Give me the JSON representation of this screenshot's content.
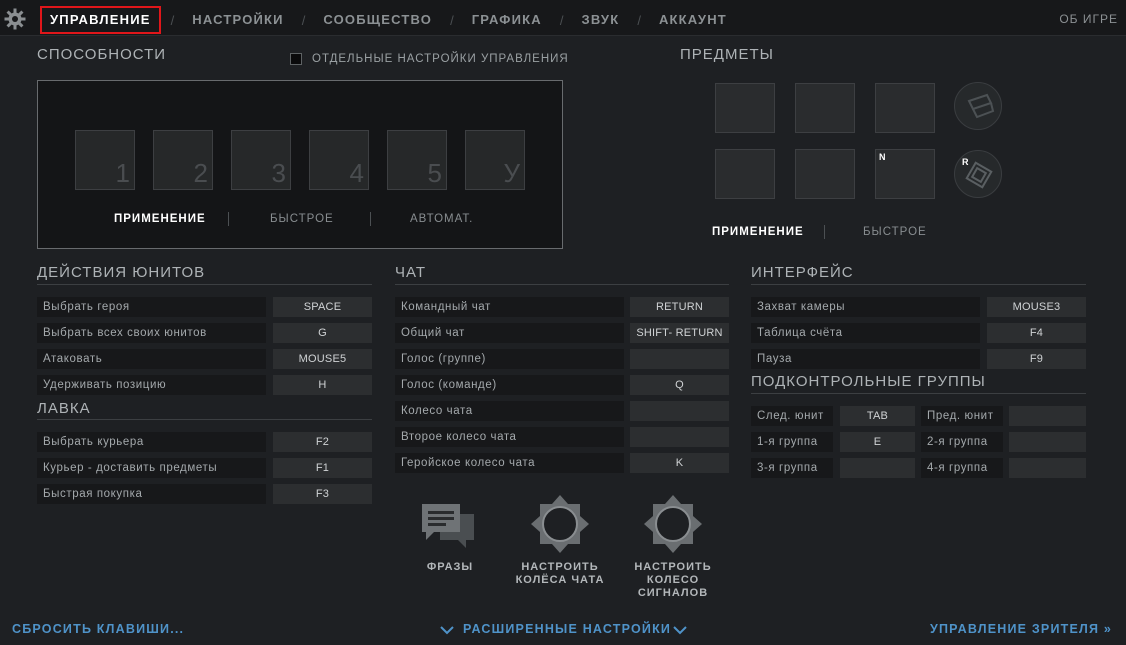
{
  "nav": {
    "tabs": [
      "УПРАВЛЕНИЕ",
      "НАСТРОЙКИ",
      "СООБЩЕСТВО",
      "ГРАФИКА",
      "ЗВУК",
      "АККАУНТ"
    ],
    "separator": "/",
    "about": "ОБ ИГРЕ"
  },
  "abilities": {
    "title": "СПОСОБНОСТИ",
    "separate_settings_label": "ОТДЕЛЬНЫЕ НАСТРОЙКИ УПРАВЛЕНИЯ",
    "slot_keys": [
      "1",
      "2",
      "3",
      "4",
      "5",
      "У"
    ],
    "modes": [
      "ПРИМЕНЕНИЕ",
      "БЫСТРОЕ",
      "АВТОМАТ."
    ]
  },
  "items": {
    "title": "ПРЕДМЕТЫ",
    "n_key": "N",
    "r_key": "R",
    "modes": [
      "ПРИМЕНЕНИЕ",
      "БЫСТРОЕ"
    ]
  },
  "unit_actions": {
    "title": "ДЕЙСТВИЯ ЮНИТОВ",
    "rows": [
      {
        "label": "Выбрать героя",
        "key": "SPACE"
      },
      {
        "label": "Выбрать всех своих юнитов",
        "key": "G"
      },
      {
        "label": "Атаковать",
        "key": "MOUSE5"
      },
      {
        "label": "Удерживать позицию",
        "key": "H"
      }
    ]
  },
  "shop": {
    "title": "ЛАВКА",
    "rows": [
      {
        "label": "Выбрать курьера",
        "key": "F2"
      },
      {
        "label": "Курьер - доставить предметы",
        "key": "F1"
      },
      {
        "label": "Быстрая покупка",
        "key": "F3"
      }
    ]
  },
  "chat": {
    "title": "ЧАТ",
    "rows": [
      {
        "label": "Командный чат",
        "key": "RETURN"
      },
      {
        "label": "Общий чат",
        "key": "SHIFT- RETURN"
      },
      {
        "label": "Голос (группе)",
        "key": ""
      },
      {
        "label": "Голос (команде)",
        "key": "Q"
      },
      {
        "label": "Колесо чата",
        "key": ""
      },
      {
        "label": "Второе колесо чата",
        "key": ""
      },
      {
        "label": "Геройское колесо чата",
        "key": "K"
      }
    ]
  },
  "interface": {
    "title": "ИНТЕРФЕЙС",
    "rows": [
      {
        "label": "Захват камеры",
        "key": "MOUSE3"
      },
      {
        "label": "Таблица счёта",
        "key": "F4"
      },
      {
        "label": "Пауза",
        "key": "F9"
      }
    ]
  },
  "control_groups": {
    "title": "ПОДКОНТРОЛЬНЫЕ ГРУППЫ",
    "rows": [
      {
        "label": "След. юнит",
        "key": "TAB",
        "label2": "Пред. юнит",
        "key2": ""
      },
      {
        "label": "1-я группа",
        "key": "E",
        "label2": "2-я группа",
        "key2": ""
      },
      {
        "label": "3-я группа",
        "key": "",
        "label2": "4-я группа",
        "key2": ""
      }
    ]
  },
  "bottom_buttons": {
    "phrases": "ФРАЗЫ",
    "chat_wheels": [
      "НАСТРОИТЬ",
      "КОЛЁСА ЧАТА"
    ],
    "ping_wheel": [
      "НАСТРОИТЬ",
      "КОЛЕСО",
      "СИГНАЛОВ"
    ]
  },
  "footer": {
    "reset": "СБРОСИТЬ КЛАВИШИ...",
    "advanced": "РАСШИРЕННЫЕ НАСТРОЙКИ",
    "spectator": "УПРАВЛЕНИЕ ЗРИТЕЛЯ »"
  },
  "colors": {
    "background": "#1e2023",
    "accent_link": "#4f93c9",
    "active_tab_outline": "#e0161a"
  }
}
